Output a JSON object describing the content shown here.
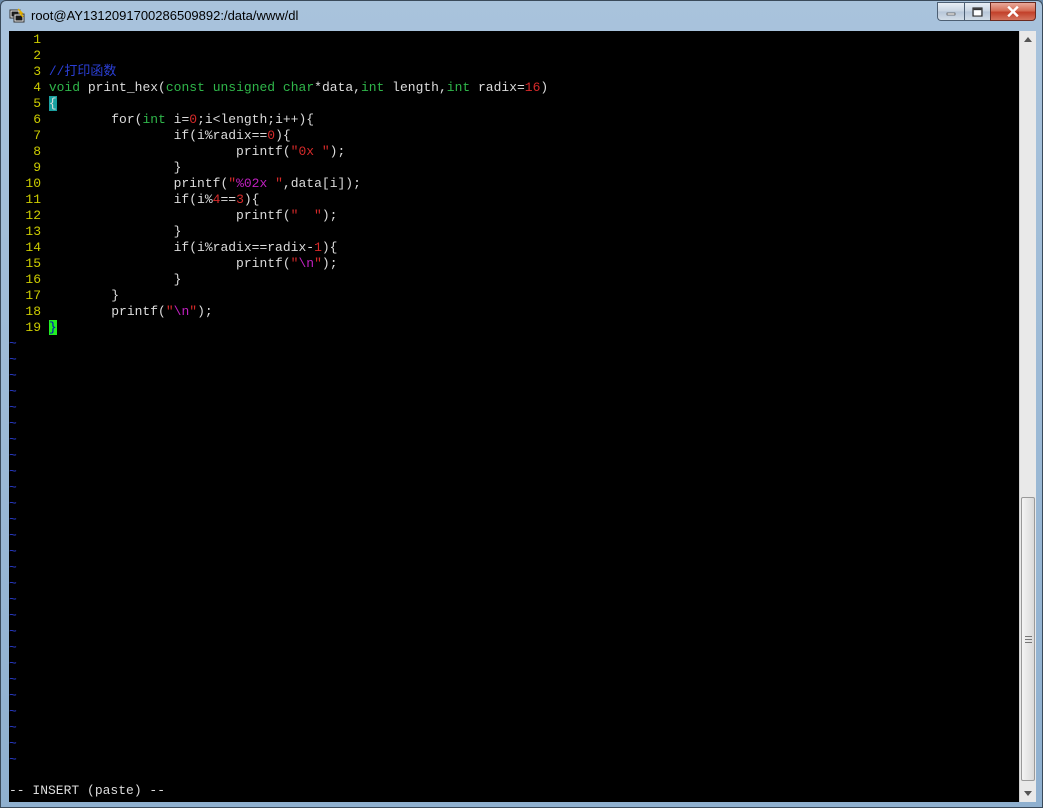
{
  "window": {
    "title": "root@AY1312091700286509892:/data/www/dl",
    "minimize_icon": "minimize-icon",
    "maximize_icon": "maximize-icon",
    "close_icon": "close-icon",
    "app_icon": "putty-icon"
  },
  "editor": {
    "colors": {
      "line_number": "#cccc00",
      "keyword": "#2fb64a",
      "number": "#d72a2a",
      "comment": "#2b3fd6",
      "cursor": "#22ee22"
    },
    "lines": [
      {
        "n": "1",
        "tokens": []
      },
      {
        "n": "2",
        "tokens": []
      },
      {
        "n": "3",
        "tokens": [
          {
            "t": "//打印函数",
            "c": "cmt"
          }
        ]
      },
      {
        "n": "4",
        "tokens": [
          {
            "t": "void",
            "c": "kw"
          },
          {
            "t": " print_hex(",
            "c": "code"
          },
          {
            "t": "const",
            "c": "kw"
          },
          {
            "t": " ",
            "c": "code"
          },
          {
            "t": "unsigned",
            "c": "kw"
          },
          {
            "t": " ",
            "c": "code"
          },
          {
            "t": "char",
            "c": "kw"
          },
          {
            "t": "*data,",
            "c": "code"
          },
          {
            "t": "int",
            "c": "kw"
          },
          {
            "t": " length,",
            "c": "code"
          },
          {
            "t": "int",
            "c": "kw"
          },
          {
            "t": " radix=",
            "c": "code"
          },
          {
            "t": "16",
            "c": "num"
          },
          {
            "t": ")",
            "c": "code"
          }
        ]
      },
      {
        "n": "5",
        "tokens": [
          {
            "t": "{",
            "c": "br-hl"
          }
        ]
      },
      {
        "n": "6",
        "tokens": [
          {
            "t": "        for(",
            "c": "code"
          },
          {
            "t": "int",
            "c": "kw"
          },
          {
            "t": " i=",
            "c": "code"
          },
          {
            "t": "0",
            "c": "num"
          },
          {
            "t": ";i<length;i++){",
            "c": "code"
          }
        ]
      },
      {
        "n": "7",
        "tokens": [
          {
            "t": "                if(i%radix==",
            "c": "code"
          },
          {
            "t": "0",
            "c": "num"
          },
          {
            "t": "){",
            "c": "code"
          }
        ]
      },
      {
        "n": "8",
        "tokens": [
          {
            "t": "                        printf(",
            "c": "code"
          },
          {
            "t": "\"0x \"",
            "c": "str"
          },
          {
            "t": ");",
            "c": "code"
          }
        ]
      },
      {
        "n": "9",
        "tokens": [
          {
            "t": "                }",
            "c": "code"
          }
        ]
      },
      {
        "n": "10",
        "tokens": [
          {
            "t": "                printf(",
            "c": "code"
          },
          {
            "t": "\"",
            "c": "str"
          },
          {
            "t": "%02x",
            "c": "spec"
          },
          {
            "t": " \"",
            "c": "str"
          },
          {
            "t": ",data[i]);",
            "c": "code"
          }
        ]
      },
      {
        "n": "11",
        "tokens": [
          {
            "t": "                if(i%",
            "c": "code"
          },
          {
            "t": "4",
            "c": "num"
          },
          {
            "t": "==",
            "c": "code"
          },
          {
            "t": "3",
            "c": "num"
          },
          {
            "t": "){",
            "c": "code"
          }
        ]
      },
      {
        "n": "12",
        "tokens": [
          {
            "t": "                        printf(",
            "c": "code"
          },
          {
            "t": "\"  \"",
            "c": "str"
          },
          {
            "t": ");",
            "c": "code"
          }
        ]
      },
      {
        "n": "13",
        "tokens": [
          {
            "t": "                }",
            "c": "code"
          }
        ]
      },
      {
        "n": "14",
        "tokens": [
          {
            "t": "                if(i%radix==radix-",
            "c": "code"
          },
          {
            "t": "1",
            "c": "num"
          },
          {
            "t": "){",
            "c": "code"
          }
        ]
      },
      {
        "n": "15",
        "tokens": [
          {
            "t": "                        printf(",
            "c": "code"
          },
          {
            "t": "\"",
            "c": "str"
          },
          {
            "t": "\\n",
            "c": "spec"
          },
          {
            "t": "\"",
            "c": "str"
          },
          {
            "t": ");",
            "c": "code"
          }
        ]
      },
      {
        "n": "16",
        "tokens": [
          {
            "t": "                }",
            "c": "code"
          }
        ]
      },
      {
        "n": "17",
        "tokens": [
          {
            "t": "        }",
            "c": "code"
          }
        ]
      },
      {
        "n": "18",
        "tokens": [
          {
            "t": "        printf(",
            "c": "code"
          },
          {
            "t": "\"",
            "c": "str"
          },
          {
            "t": "\\n",
            "c": "spec"
          },
          {
            "t": "\"",
            "c": "str"
          },
          {
            "t": ");",
            "c": "code"
          }
        ]
      },
      {
        "n": "19",
        "tokens": [
          {
            "t": "}",
            "c": "cursor"
          }
        ]
      }
    ],
    "tilde": "~",
    "status": "-- INSERT (paste) --"
  }
}
